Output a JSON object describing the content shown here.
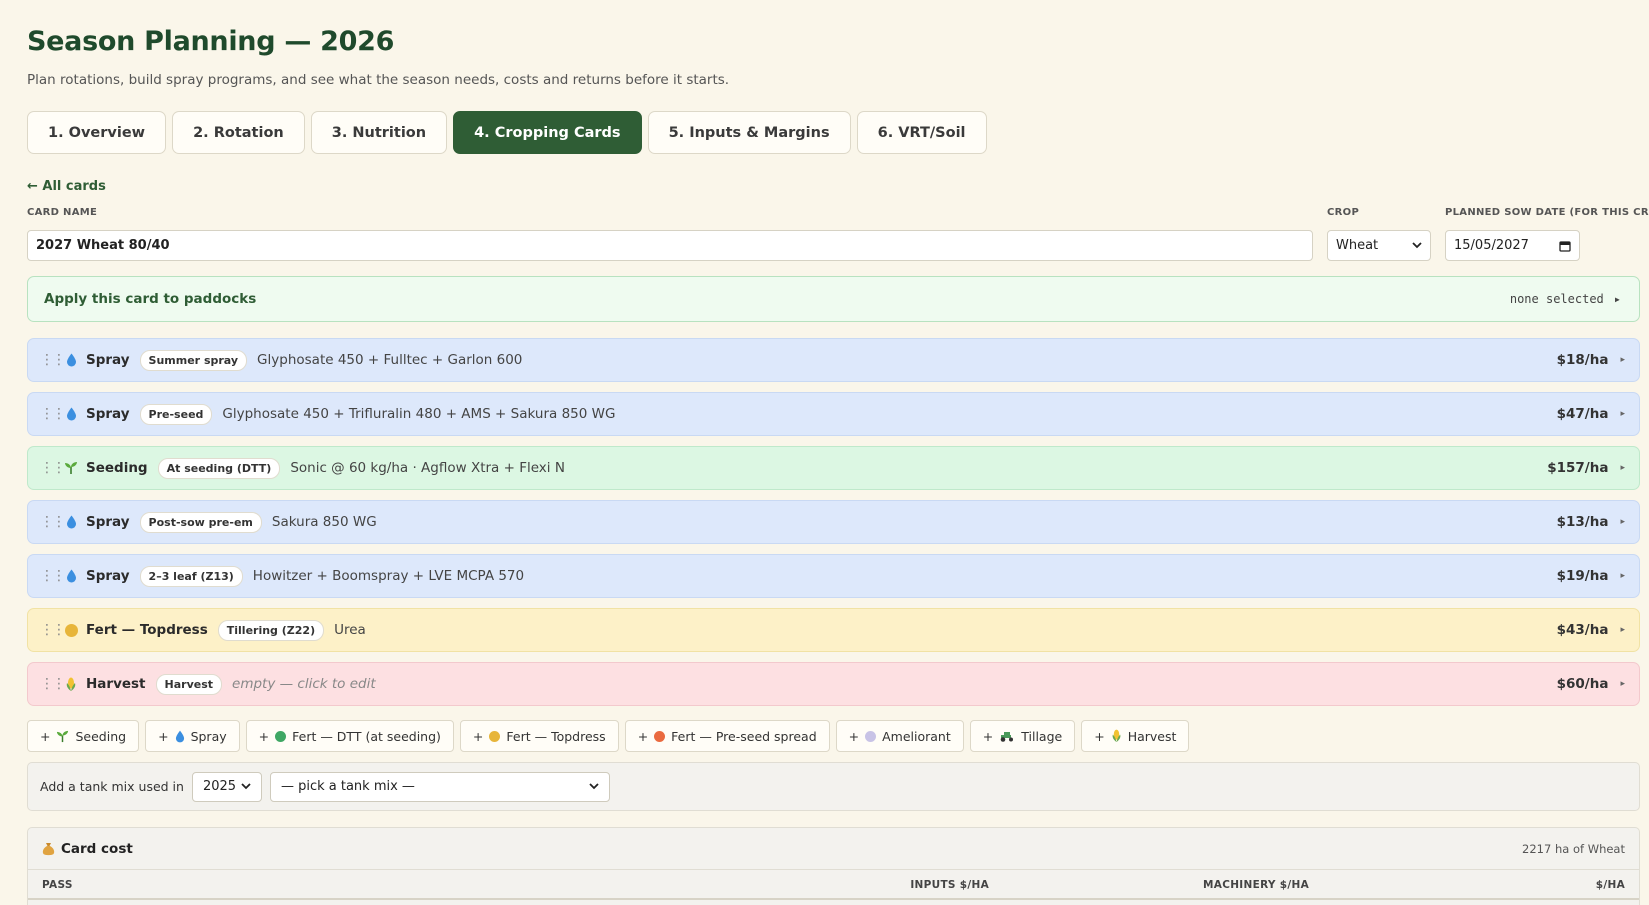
{
  "header": {
    "title": "Season Planning — 2026",
    "subtitle": "Plan rotations, build spray programs, and see what the season needs, costs and returns before it starts."
  },
  "tabs": [
    {
      "label": "1. Overview",
      "active": false
    },
    {
      "label": "2. Rotation",
      "active": false
    },
    {
      "label": "3. Nutrition",
      "active": false
    },
    {
      "label": "4. Cropping Cards",
      "active": true
    },
    {
      "label": "5. Inputs & Margins",
      "active": false
    },
    {
      "label": "6. VRT/Soil",
      "active": false
    }
  ],
  "back_link": "← All cards",
  "form": {
    "card_name_label": "CARD NAME",
    "card_name_value": "2027 Wheat 80/40",
    "crop_label": "CROP",
    "crop_value": "Wheat",
    "sow_date_label": "PLANNED SOW DATE (FOR THIS CROP)",
    "sow_date_value": "15/05/2027"
  },
  "apply": {
    "title": "Apply this card to paddocks",
    "status": "none selected",
    "caret": "▸"
  },
  "passes": [
    {
      "type": "Spray",
      "kind": "spray",
      "icon": "droplet-icon",
      "tag": "Summer spray",
      "desc": "Glyphosate 450 + Fulltec + Garlon 600",
      "cost": "$18/ha"
    },
    {
      "type": "Spray",
      "kind": "spray",
      "icon": "droplet-icon",
      "tag": "Pre-seed",
      "desc": "Glyphosate 450 + Trifluralin 480 + AMS + Sakura 850 WG",
      "cost": "$47/ha"
    },
    {
      "type": "Seeding",
      "kind": "seed",
      "icon": "seedling-icon",
      "tag": "At seeding (DTT)",
      "desc": "Sonic @ 60 kg/ha · Agflow Xtra + Flexi N",
      "cost": "$157/ha"
    },
    {
      "type": "Spray",
      "kind": "spray",
      "icon": "droplet-icon",
      "tag": "Post-sow pre-em",
      "desc": "Sakura 850 WG",
      "cost": "$13/ha"
    },
    {
      "type": "Spray",
      "kind": "spray",
      "icon": "droplet-icon",
      "tag": "2–3 leaf (Z13)",
      "desc": "Howitzer + Boomspray + LVE MCPA 570",
      "cost": "$19/ha"
    },
    {
      "type": "Fert — Topdress",
      "kind": "fert",
      "icon": "yellow-circle-icon",
      "tag": "Tillering (Z22)",
      "desc": "Urea",
      "cost": "$43/ha"
    },
    {
      "type": "Harvest",
      "kind": "harv",
      "icon": "corn-icon",
      "tag": "Harvest",
      "desc": "empty — click to edit",
      "cost": "$60/ha"
    }
  ],
  "add_buttons": [
    {
      "label": "Seeding",
      "icon": "seedling-icon"
    },
    {
      "label": "Spray",
      "icon": "droplet-icon"
    },
    {
      "label": "Fert — DTT (at seeding)",
      "icon": "green-circle-icon",
      "color": "#3fa764"
    },
    {
      "label": "Fert — Topdress",
      "icon": "yellow-circle-icon",
      "color": "#e7b53a"
    },
    {
      "label": "Fert — Pre-seed spread",
      "icon": "orange-circle-icon",
      "color": "#ea6a3f"
    },
    {
      "label": "Ameliorant",
      "icon": "lilac-circle-icon",
      "color": "#c8c3e6"
    },
    {
      "label": "Tillage",
      "icon": "tractor-icon"
    },
    {
      "label": "Harvest",
      "icon": "corn-icon"
    }
  ],
  "add_prefix": "+",
  "tankmix": {
    "label": "Add a tank mix used in",
    "year": "2025",
    "placeholder": "— pick a tank mix —"
  },
  "card_cost": {
    "title": "Card cost",
    "summary": "2217 ha of Wheat",
    "columns": [
      "PASS",
      "INPUTS $/HA",
      "MACHINERY $/HA",
      "$/HA"
    ]
  },
  "colors": {
    "accent": "#2f5d35",
    "spray_bg": "#dde8fb",
    "seed_bg": "#dcf7e3",
    "fert_bg": "#fdf1c8",
    "harvest_bg": "#fde0e2"
  }
}
